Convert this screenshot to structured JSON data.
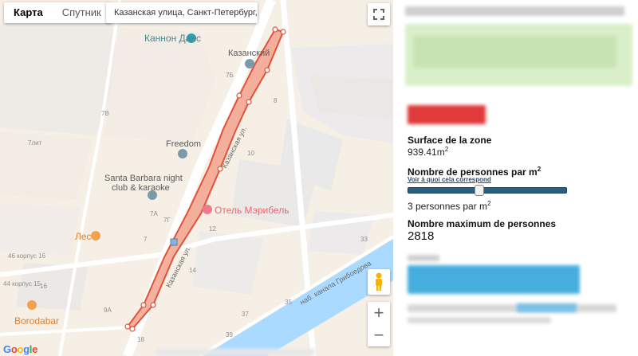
{
  "map": {
    "type_tabs": [
      {
        "label": "Карта",
        "active": true
      },
      {
        "label": "Спутник",
        "active": false
      }
    ],
    "search_address": "Казанская улица, Санкт-Петербург, Ро...",
    "google_logo": "Google",
    "zoom_in": "+",
    "zoom_out": "−",
    "labels": {
      "kannon_dance": "Каннон Данс",
      "kazansky": "Казанский",
      "freedom": "Freedom",
      "santa_barbara_1": "Santa Barbara night",
      "santa_barbara_2": "club & karaoke",
      "hotel": "Отель Мэрибель",
      "les": "Лес",
      "borodabar": "Borodabar",
      "street_kazanskaya_1": "Казанская ул.",
      "street_kazanskaya_2": "Казанская ул.",
      "canal": "наб. канала Грибоедова"
    },
    "house_numbers": {
      "n7b": "7Б",
      "n7b2": "7B",
      "n8": "8",
      "n7lit": "7лит",
      "n10": "10",
      "n7a": "7А",
      "n7g": "7Г",
      "n12": "12",
      "n7": "7",
      "n46": "46 корпус 16",
      "n14": "14",
      "n33": "33",
      "n35": "35",
      "n37": "37",
      "n9a": "9А",
      "n18": "18",
      "n39": "39",
      "n44": "44 корпус 15",
      "n16": "16"
    },
    "colors": {
      "zone_stroke": "#e0523a",
      "zone_fill": "#f3a38e",
      "water": "#aadaff"
    }
  },
  "panel": {
    "surface_title": "Surface de la zone",
    "surface_value": "939.41m",
    "surface_unit_sup": "2",
    "density_title": "Nombre de personnes par m",
    "density_title_sup": "2",
    "density_link": "Voir à quoi cela correspond",
    "density_fraction": 0.45,
    "density_value": "3 personnes par m",
    "density_value_sup": "2",
    "max_title": "Nombre maximum de personnes",
    "max_value": "2818"
  }
}
